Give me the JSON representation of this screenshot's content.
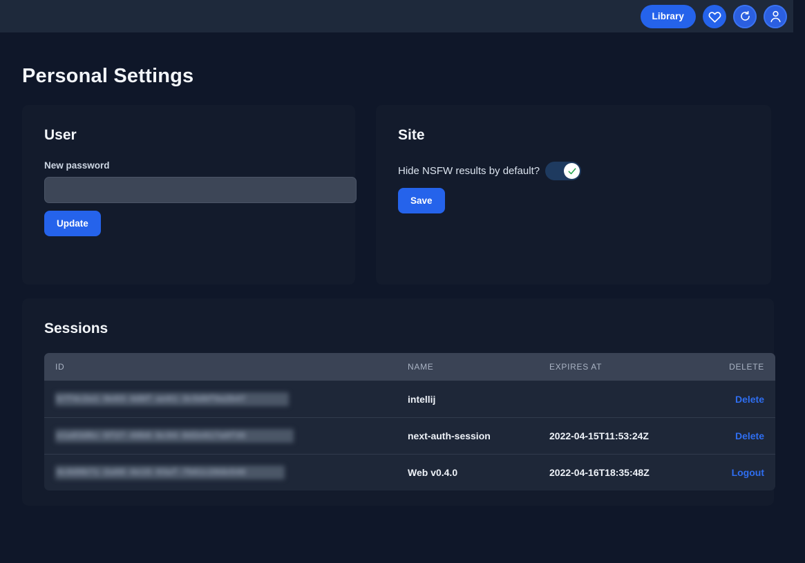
{
  "topbar": {
    "library_label": "Library",
    "icons": [
      {
        "name": "heart-icon"
      },
      {
        "name": "refresh-icon"
      },
      {
        "name": "user-avatar-icon"
      }
    ],
    "accent_color": "#2563eb"
  },
  "page": {
    "title": "Personal Settings",
    "background_color": "#0f1729",
    "card_color": "#131b2c"
  },
  "user_card": {
    "title": "User",
    "password_label": "New password",
    "password_value": "",
    "password_placeholder": "",
    "update_label": "Update"
  },
  "site_card": {
    "title": "Site",
    "nsfw_label": "Hide NSFW results by default?",
    "nsfw_enabled": true,
    "save_label": "Save",
    "check_color": "#22a24a"
  },
  "sessions": {
    "title": "Sessions",
    "columns": [
      "ID",
      "NAME",
      "EXPIRES AT",
      "DELETE"
    ],
    "rows": [
      {
        "id": "b7f4c2a1-9e03-4d8f-ae61-3c5d0f9a2b47",
        "name": "intellij",
        "expires_at": "",
        "action": "Delete"
      },
      {
        "id": "e1a83d6c-5f27-49b0-bc94-8d2e617a0f35",
        "name": "next-auth-session",
        "expires_at": "2022-04-15T11:53:24Z",
        "action": "Delete"
      },
      {
        "id": "4c0d9b71-2a68-4e15-93af-7b61c28de540",
        "name": "Web v0.4.0",
        "expires_at": "2022-04-16T18:35:48Z",
        "action": "Logout"
      }
    ],
    "link_color": "#2f6ef0"
  }
}
